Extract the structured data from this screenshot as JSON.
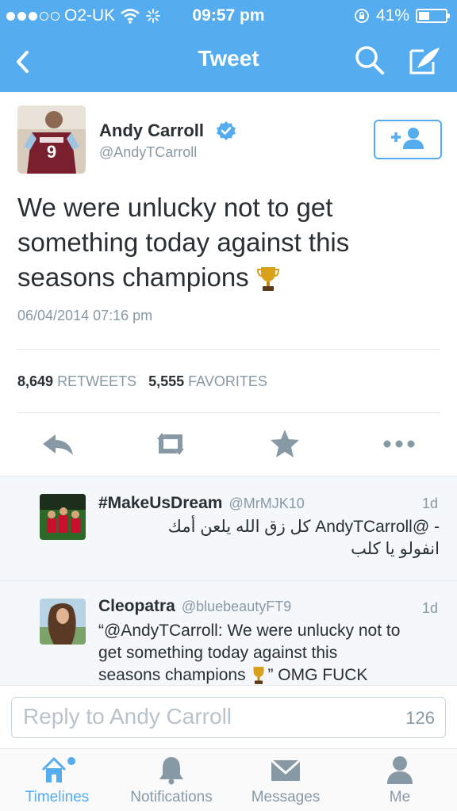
{
  "status_bar": {
    "carrier": "O2-UK",
    "time": "09:57 pm",
    "battery": "41%",
    "battery_level": 0.41
  },
  "nav": {
    "title": "Tweet"
  },
  "tweet": {
    "author_name": "Andy Carroll",
    "author_handle": "@AndyTCarroll",
    "text": "We were unlucky not to get something today against this seasons champions",
    "timestamp": "06/04/2014 07:16 pm",
    "retweets_count": "8,649",
    "retweets_label": "RETWEETS",
    "favorites_count": "5,555",
    "favorites_label": "FAVORITES"
  },
  "replies": [
    {
      "name": "#MakeUsDream",
      "handle": "@MrMJK10",
      "time": "1d",
      "text_line1": "- @AndyTCarroll كل زق الله يلعن أمك",
      "text_line2": "انفولو يا كلب"
    },
    {
      "name": "Cleopatra",
      "handle": "@bluebeautyFT9",
      "time": "1d",
      "text_line1": "“@AndyTCarroll: We were unlucky not to",
      "text_line2": "get something today against this",
      "text_line3_a": "seasons champions",
      "text_line3_b": "” OMG FUCK"
    }
  ],
  "reply_box": {
    "placeholder": "Reply to Andy Carroll",
    "char_count": "126"
  },
  "tabs": [
    {
      "label": "Timelines",
      "icon": "home-icon"
    },
    {
      "label": "Notifications",
      "icon": "bell-icon"
    },
    {
      "label": "Messages",
      "icon": "envelope-icon"
    },
    {
      "label": "Me",
      "icon": "person-icon"
    }
  ],
  "colors": {
    "brand_blue": "#55acee",
    "text": "#292f33",
    "muted": "#8899a6"
  }
}
